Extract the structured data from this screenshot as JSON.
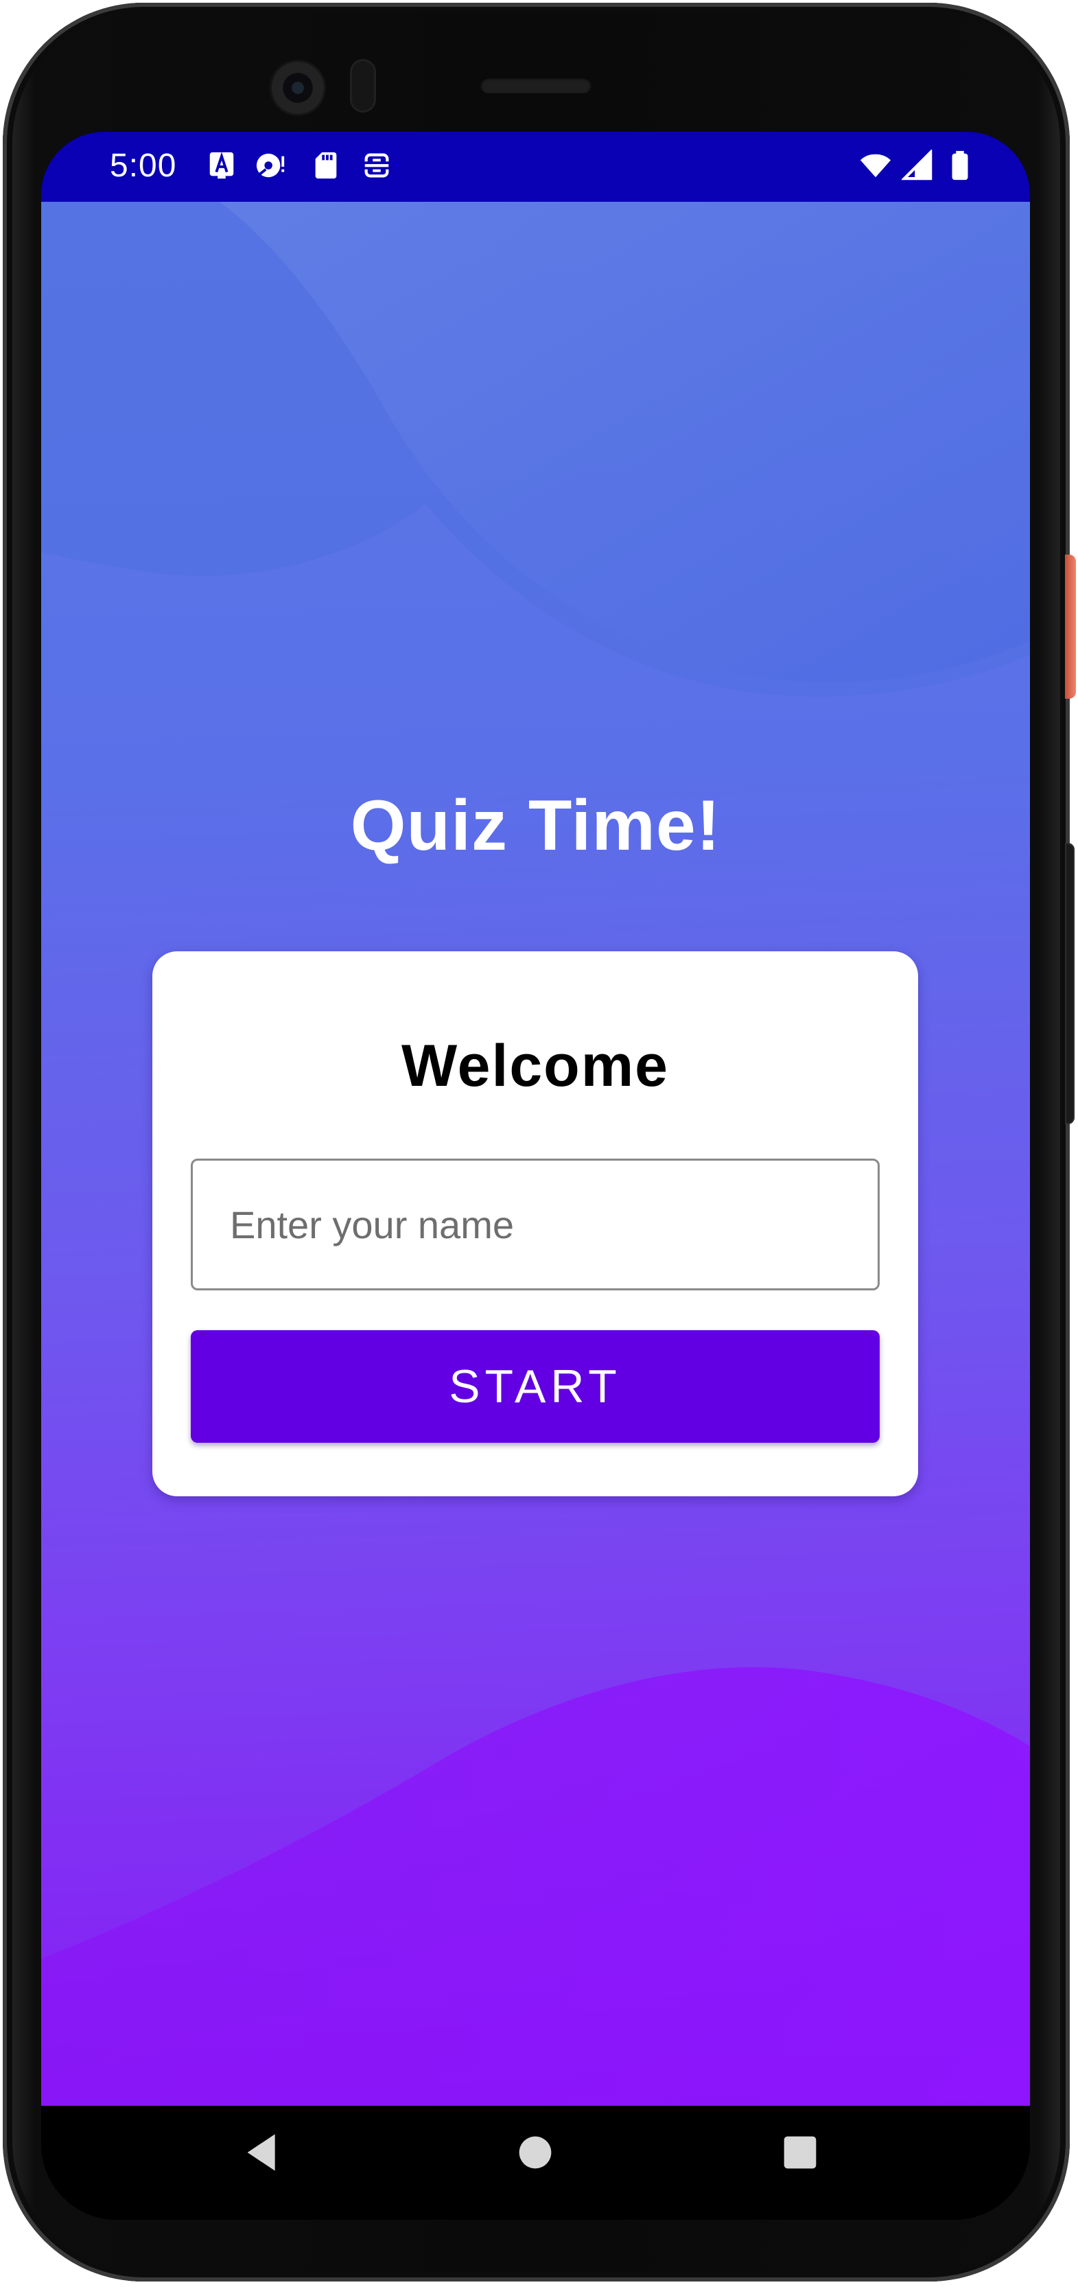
{
  "status_bar": {
    "time": "5:00",
    "left_icons": [
      "accessibility-a-icon",
      "disc-sync-icon",
      "sd-card-icon",
      "screen-capture-icon"
    ],
    "right_icons": [
      "wifi-icon",
      "signal-icon",
      "battery-icon"
    ]
  },
  "app": {
    "title": "Quiz Time!",
    "card": {
      "heading": "Welcome",
      "name_input": {
        "placeholder": "Enter your name",
        "value": ""
      },
      "start_button_label": "START"
    }
  },
  "nav_bar": {
    "icons": [
      "back-icon",
      "home-icon",
      "recents-icon"
    ]
  },
  "colors": {
    "status_bar": "#0a00b4",
    "gradient_top": "#5b79e4",
    "gradient_bottom": "#8818f5",
    "button": "#6200e3",
    "card": "#ffffff"
  }
}
